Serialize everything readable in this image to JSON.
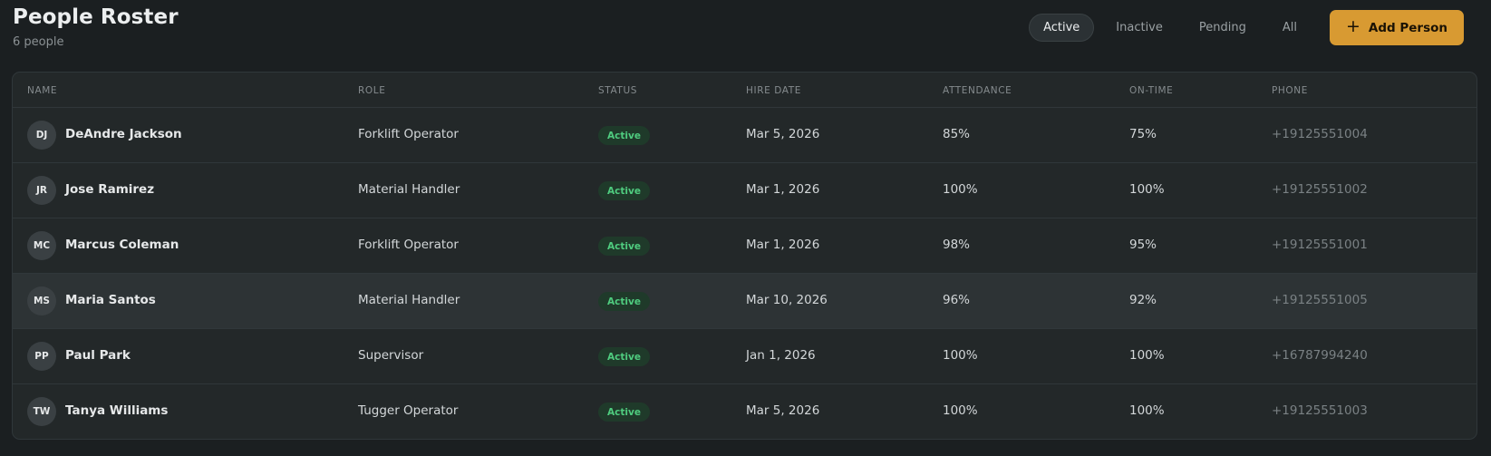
{
  "header": {
    "title": "People Roster",
    "subtitle": "6 people"
  },
  "filters": [
    {
      "label": "Active",
      "active": true
    },
    {
      "label": "Inactive",
      "active": false
    },
    {
      "label": "Pending",
      "active": false
    },
    {
      "label": "All",
      "active": false
    }
  ],
  "add_button": {
    "label": "Add Person",
    "icon": "plus-icon"
  },
  "colors": {
    "background": "#1b1f21",
    "accent": "#d89a32",
    "status_active": "#4fcc7f"
  },
  "table": {
    "columns": [
      "NAME",
      "ROLE",
      "STATUS",
      "HIRE DATE",
      "ATTENDANCE",
      "ON-TIME",
      "PHONE"
    ],
    "rows": [
      {
        "initials": "DJ",
        "name": "DeAndre Jackson",
        "role": "Forklift Operator",
        "status": "Active",
        "hire_date": "Mar 5, 2026",
        "attendance": "85%",
        "on_time": "75%",
        "phone": "+19125551004"
      },
      {
        "initials": "JR",
        "name": "Jose Ramirez",
        "role": "Material Handler",
        "status": "Active",
        "hire_date": "Mar 1, 2026",
        "attendance": "100%",
        "on_time": "100%",
        "phone": "+19125551002"
      },
      {
        "initials": "MC",
        "name": "Marcus Coleman",
        "role": "Forklift Operator",
        "status": "Active",
        "hire_date": "Mar 1, 2026",
        "attendance": "98%",
        "on_time": "95%",
        "phone": "+19125551001"
      },
      {
        "initials": "MS",
        "name": "Maria Santos",
        "role": "Material Handler",
        "status": "Active",
        "hire_date": "Mar 10, 2026",
        "attendance": "96%",
        "on_time": "92%",
        "phone": "+19125551005"
      },
      {
        "initials": "PP",
        "name": "Paul Park",
        "role": "Supervisor",
        "status": "Active",
        "hire_date": "Jan 1, 2026",
        "attendance": "100%",
        "on_time": "100%",
        "phone": "+16787994240"
      },
      {
        "initials": "TW",
        "name": "Tanya Williams",
        "role": "Tugger Operator",
        "status": "Active",
        "hire_date": "Mar 5, 2026",
        "attendance": "100%",
        "on_time": "100%",
        "phone": "+19125551003"
      }
    ]
  }
}
